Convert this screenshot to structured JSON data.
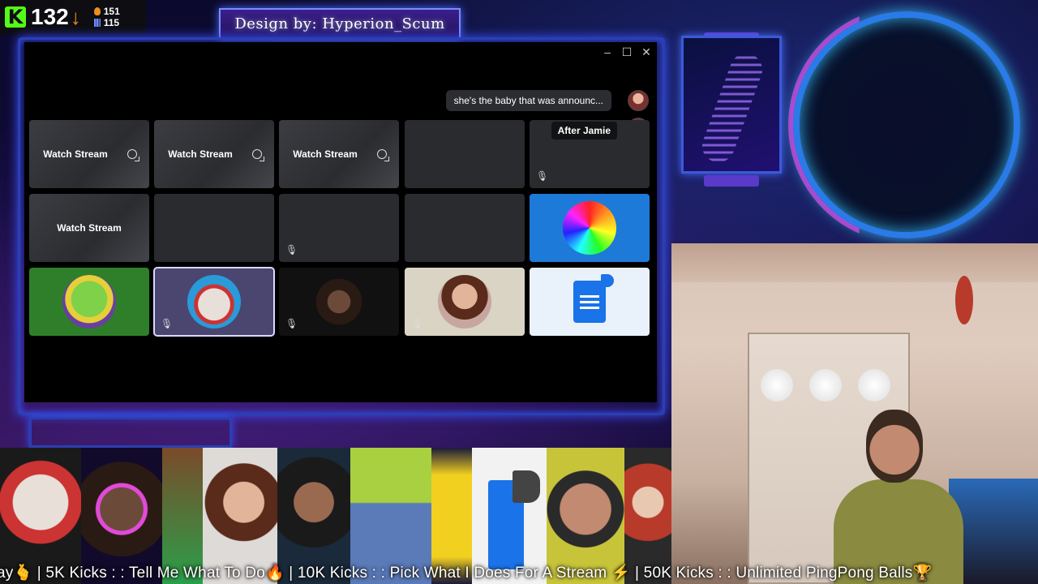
{
  "header": {
    "viewer_count": "132",
    "stat_followers": "151",
    "stat_subs": "115"
  },
  "banner": {
    "title": "Design by: Hyperion_Scum"
  },
  "chat": {
    "message": "she's the baby that was announc..."
  },
  "tooltip": {
    "label": "After Jamie"
  },
  "tiles": {
    "watch_label": "Watch Stream"
  },
  "ticker": {
    "text": "ay🫰 | 5K Kicks : : Tell Me What To Do🔥 | 10K Kicks : : Pick What I Does For A Stream ⚡ | 50K Kicks : : Unlimited PingPong Balls🏆"
  },
  "colors": {
    "kick_green": "#53fc18",
    "accent_orange": "#f08c1a",
    "frame_blue": "#2a40b0",
    "ring_blue": "#2a7ae8",
    "ring_purple": "#c84adf"
  },
  "icons": [
    "kick-logo-icon",
    "down-arrow-icon",
    "fire-icon",
    "chart-icon",
    "minimize-icon",
    "maximize-icon",
    "close-icon",
    "popout-icon",
    "muted-mic-icon",
    "document-speaker-icon"
  ]
}
